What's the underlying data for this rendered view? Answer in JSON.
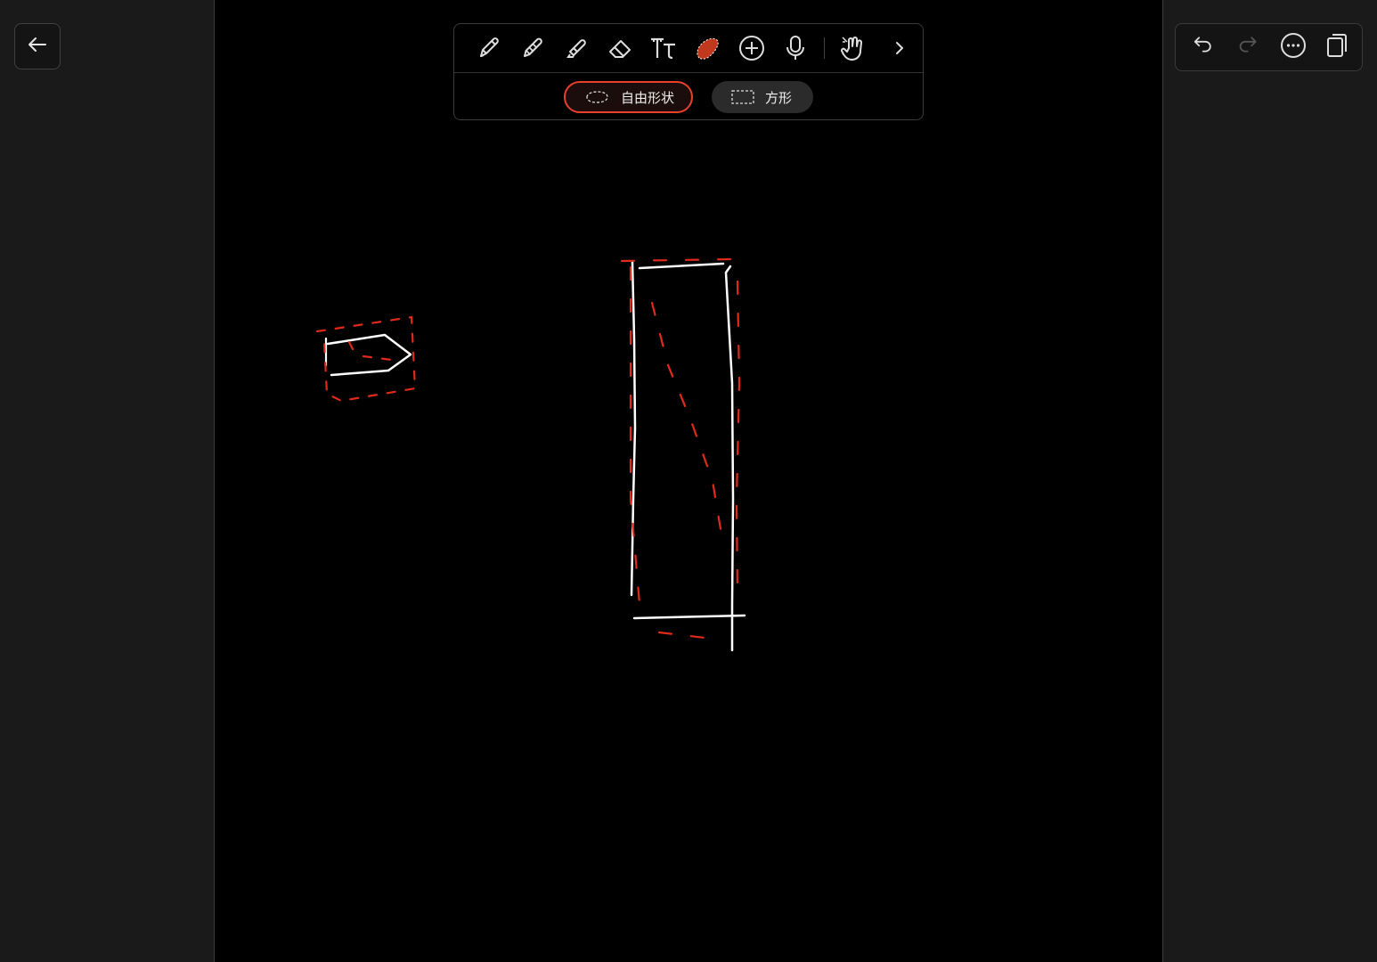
{
  "app": {
    "back_icon": "arrow-left-icon"
  },
  "toolbar": {
    "tools": [
      {
        "name": "pen",
        "icon": "pen-icon"
      },
      {
        "name": "pencil",
        "icon": "pencil-icon"
      },
      {
        "name": "highlighter",
        "icon": "highlighter-icon"
      },
      {
        "name": "eraser",
        "icon": "eraser-icon"
      },
      {
        "name": "text",
        "icon": "text-tool-icon",
        "glyph": "Tt"
      },
      {
        "name": "lasso",
        "icon": "lasso-icon",
        "selected": true
      },
      {
        "name": "insert",
        "icon": "plus-circle-icon"
      },
      {
        "name": "audio",
        "icon": "microphone-icon"
      },
      {
        "name": "hand",
        "icon": "hand-pointer-icon"
      },
      {
        "name": "more",
        "icon": "chevron-right-icon"
      }
    ],
    "selection_modes": {
      "freeform_label": "自由形状",
      "rectangle_label": "方形",
      "selected": "freeform"
    }
  },
  "right_tools": [
    {
      "name": "undo",
      "icon": "undo-icon",
      "enabled": true
    },
    {
      "name": "redo",
      "icon": "redo-icon",
      "enabled": false
    },
    {
      "name": "more",
      "icon": "more-icon",
      "enabled": true
    },
    {
      "name": "pages",
      "icon": "pages-icon",
      "enabled": true
    }
  ],
  "colors": {
    "accent": "#e8402b",
    "sidebar": "#1a1a1a",
    "canvas": "#000000",
    "ink": "#ffffff"
  }
}
